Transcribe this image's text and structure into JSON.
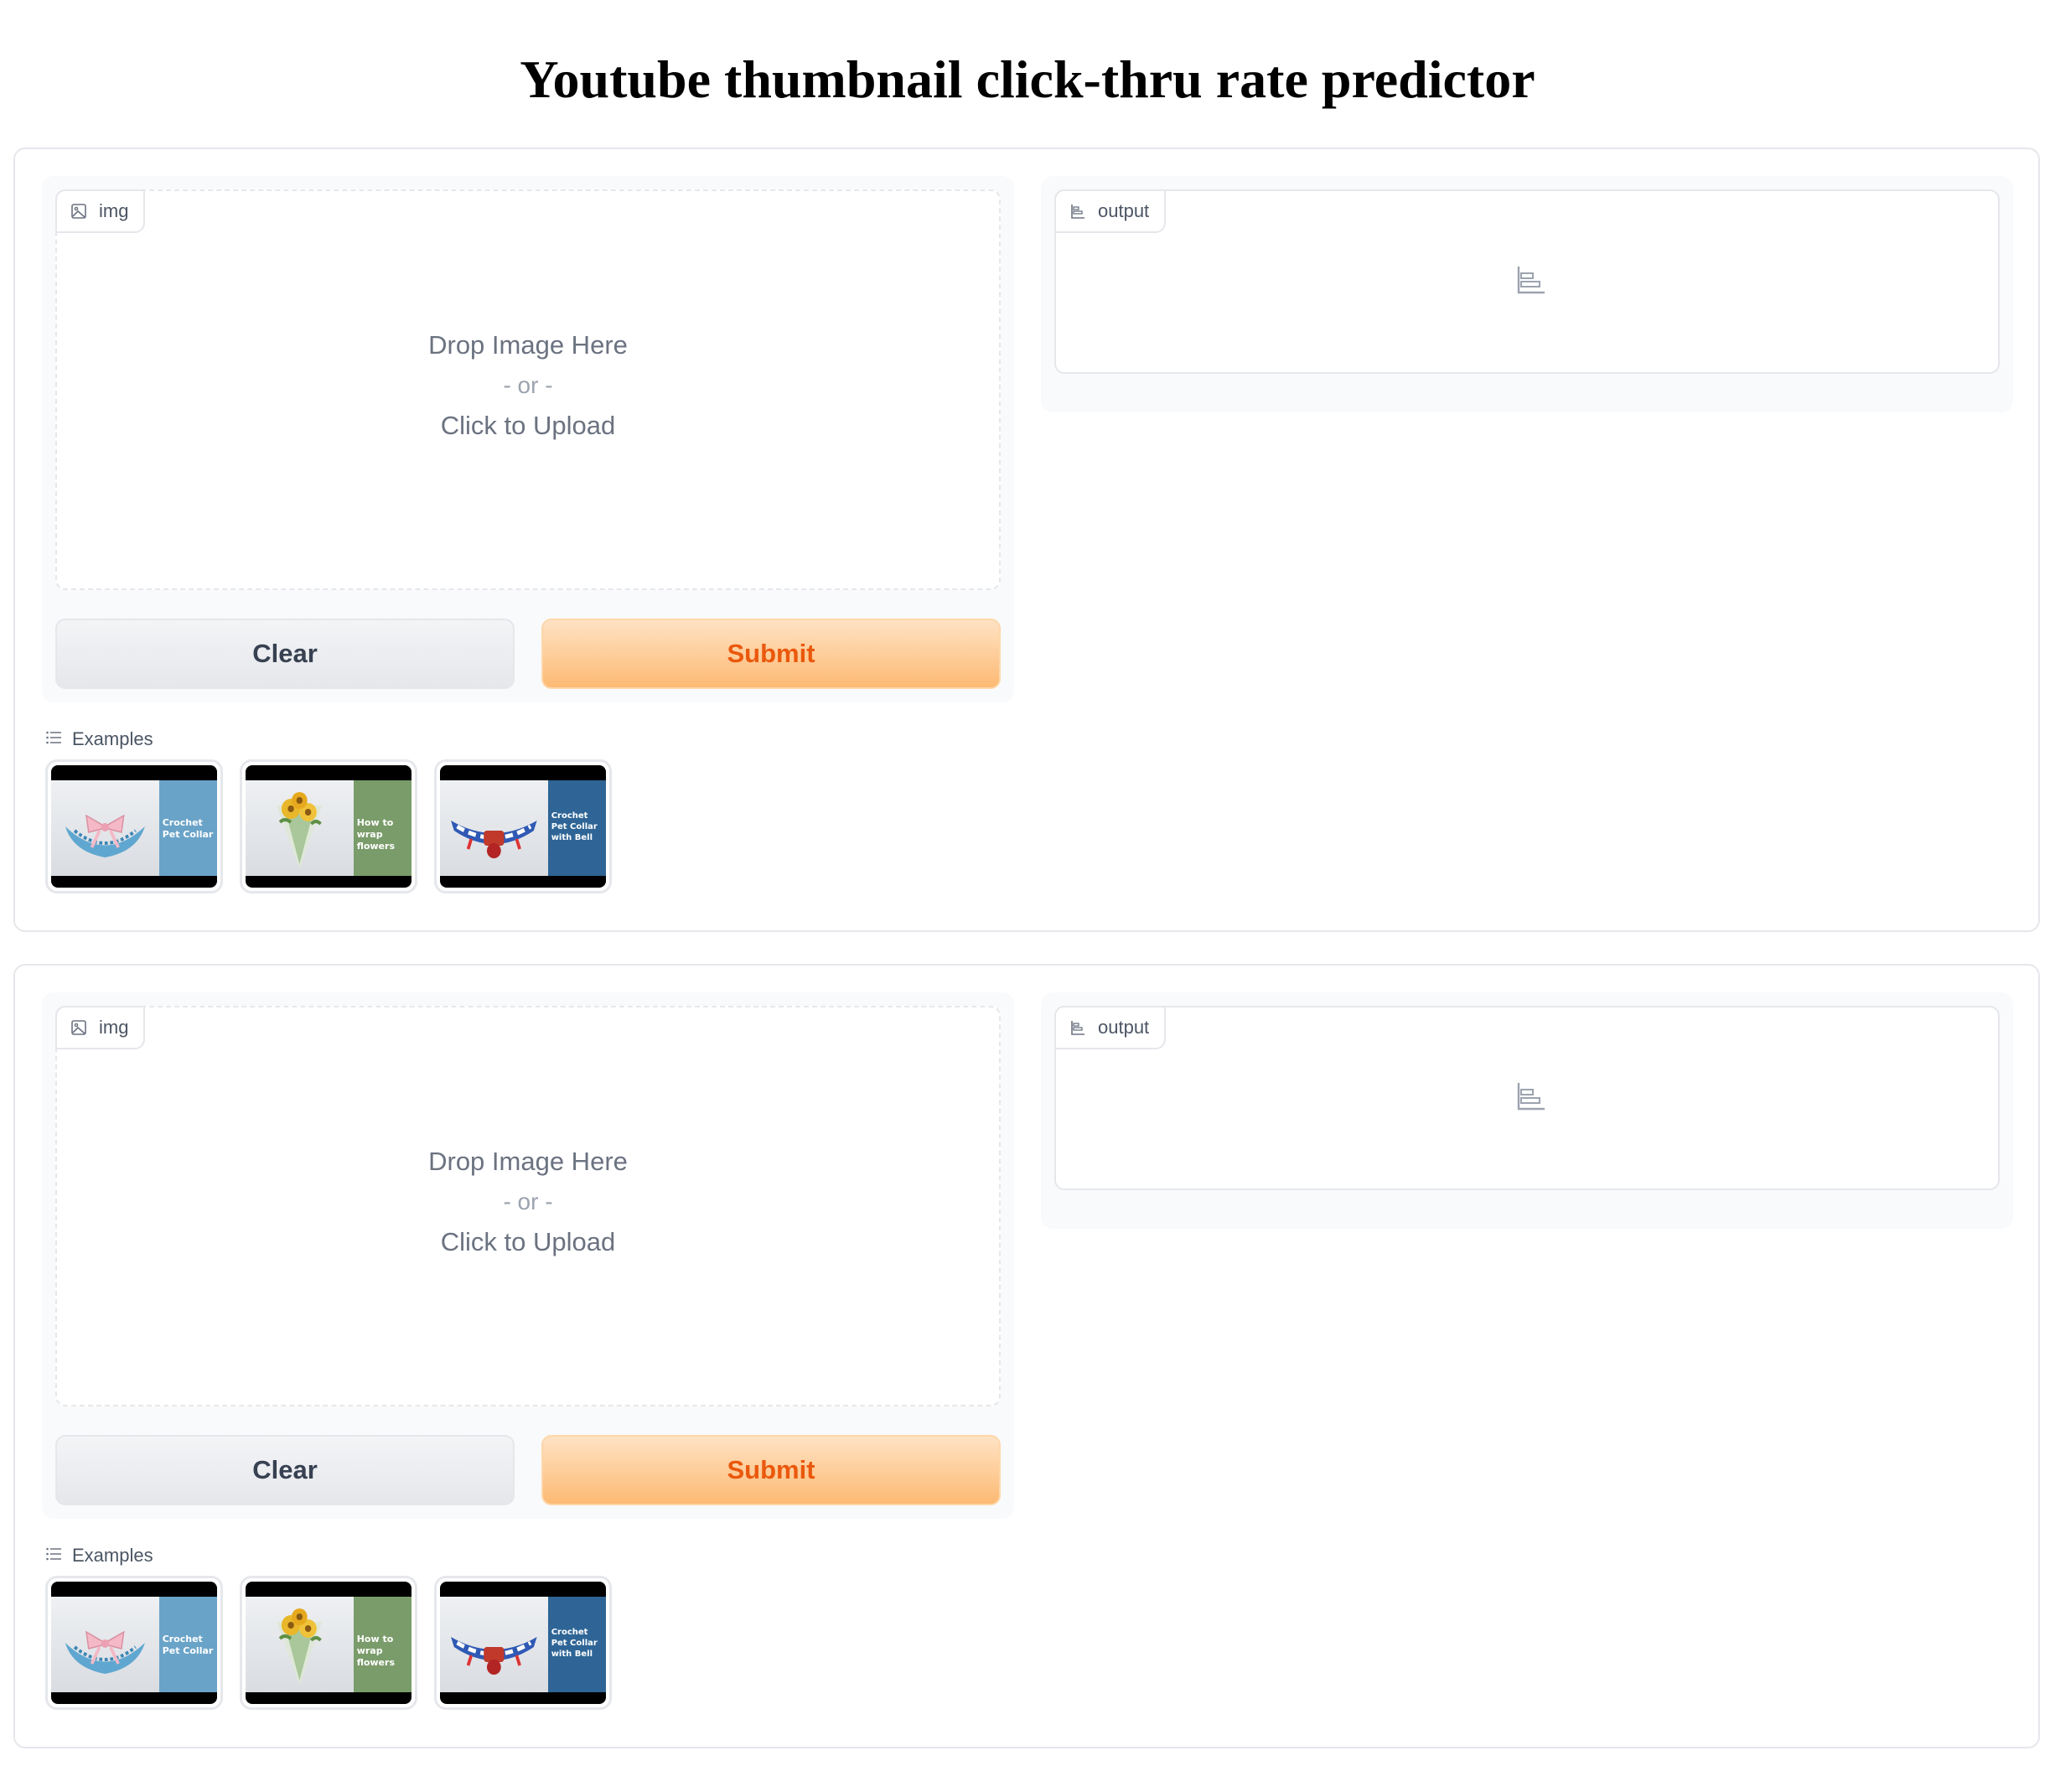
{
  "page": {
    "title": "Youtube thumbnail click-thru rate predictor"
  },
  "panels": [
    {
      "input": {
        "label": "img",
        "drop": "Drop Image Here",
        "or": "- or -",
        "click": "Click to Upload"
      },
      "output": {
        "label": "output"
      },
      "buttons": {
        "clear": "Clear",
        "submit": "Submit"
      },
      "examples": {
        "label": "Examples",
        "items": [
          {
            "text": "Crochet Pet Collar",
            "side_color": "#6aa3c8",
            "icon": "pink-collar-photo"
          },
          {
            "text": "How to wrap flowers",
            "side_color": "#7a9c6a",
            "icon": "sunflower-bouquet-photo"
          },
          {
            "text": "Crochet Pet Collar with Bell",
            "side_color": "#2e6596",
            "icon": "blue-collar-photo"
          }
        ]
      }
    },
    {
      "input": {
        "label": "img",
        "drop": "Drop Image Here",
        "or": "- or -",
        "click": "Click to Upload"
      },
      "output": {
        "label": "output"
      },
      "buttons": {
        "clear": "Clear",
        "submit": "Submit"
      },
      "examples": {
        "label": "Examples",
        "items": [
          {
            "text": "Crochet Pet Collar",
            "side_color": "#6aa3c8",
            "icon": "pink-collar-photo"
          },
          {
            "text": "How to wrap flowers",
            "side_color": "#7a9c6a",
            "icon": "sunflower-bouquet-photo"
          },
          {
            "text": "Crochet Pet Collar with Bell",
            "side_color": "#2e6596",
            "icon": "blue-collar-photo"
          }
        ]
      }
    }
  ],
  "colors": {
    "accent": "#ea580c",
    "submit_bg": "#fdba74",
    "border": "#e5e7eb",
    "panel_bg": "#f9fafb"
  }
}
